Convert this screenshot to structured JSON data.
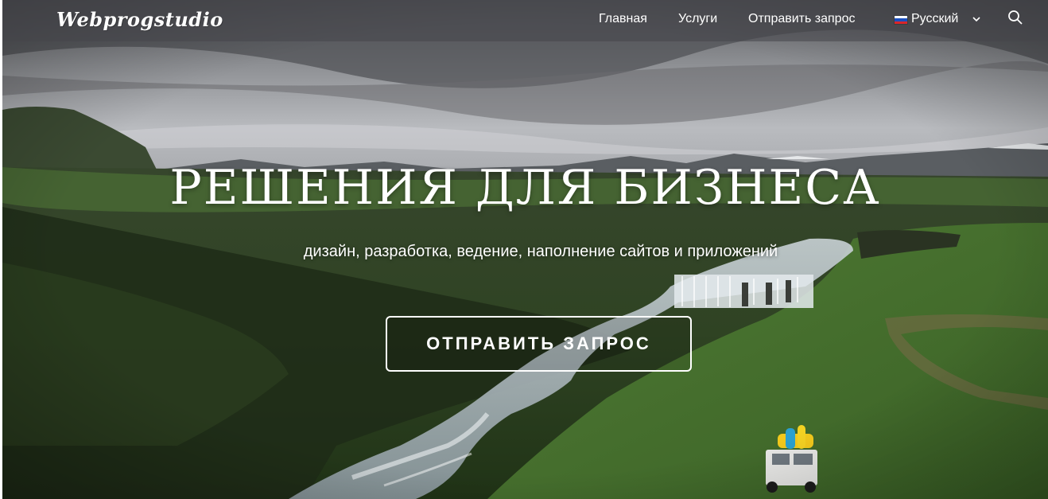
{
  "header": {
    "logo_text": "Webprogstudio",
    "nav": [
      {
        "label": "Главная"
      },
      {
        "label": "Услуги"
      },
      {
        "label": "Отправить запрос"
      }
    ],
    "language": {
      "label": "Русский",
      "flag_colors": [
        "#ffffff",
        "#1a4fbf",
        "#d9262a"
      ]
    },
    "search_icon": "search-icon",
    "chevron_icon": "chevron-down-icon"
  },
  "hero": {
    "title": "РЕШЕНИЯ ДЛЯ БИЗНЕСА",
    "subtitle": "дизайн, разработка, ведение, наполнение сайтов и приложений",
    "cta_label": "ОТПРАВИТЬ ЗАПРОС",
    "background": "Landscape photo: cloudy sky, green highland valley, river with waterfall, off-road vehicle"
  },
  "colors": {
    "header_bg": "#46464a",
    "text": "#ffffff"
  }
}
